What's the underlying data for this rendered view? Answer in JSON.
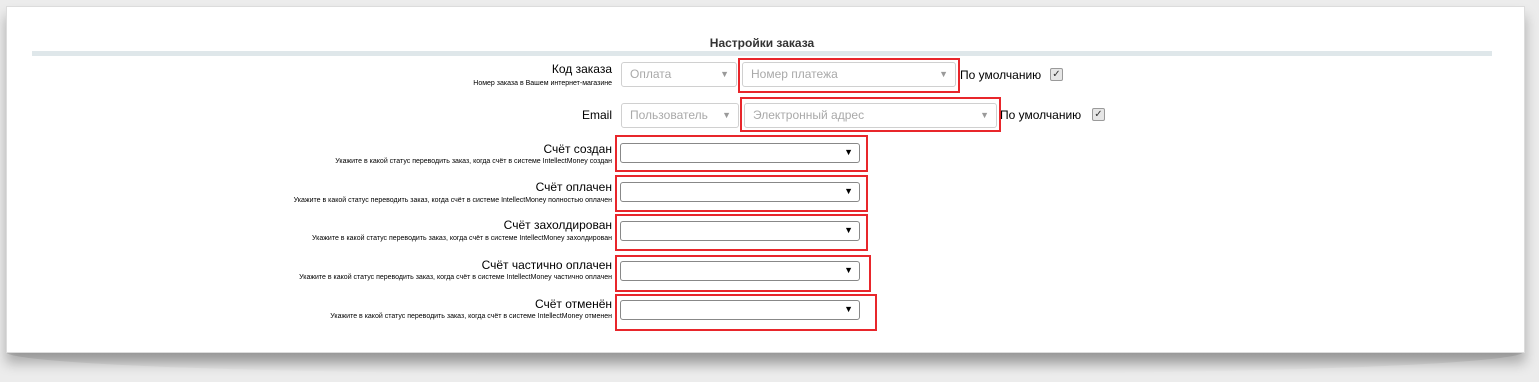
{
  "section_title": "Настройки заказа",
  "rows": {
    "order_code": {
      "label": "Код заказа",
      "hint": "Номер заказа в Вашем интернет-магазине",
      "source_value": "Оплата",
      "field_value": "Номер платежа",
      "default_label": "По умолчанию",
      "default_checked": true
    },
    "email": {
      "label": "Email",
      "source_value": "Пользователь",
      "field_value": "Электронный адрес",
      "default_label": "По умолчанию",
      "default_checked": true
    },
    "status_created": {
      "label": "Счёт создан",
      "hint": "Укажите в какой статус переводить заказ, когда счёт в системе IntellectMoney создан",
      "value": ""
    },
    "status_paid": {
      "label": "Счёт оплачен",
      "hint": "Укажите в какой статус переводить заказ, когда счёт в системе IntellectMoney полностью оплачен",
      "value": ""
    },
    "status_hold": {
      "label": "Счёт захолдирован",
      "hint": "Укажите в какой статус переводить заказ, когда счёт в системе IntellectMoney захолдирован",
      "value": ""
    },
    "status_partial": {
      "label": "Счёт частично оплачен",
      "hint": "Укажите в какой статус переводить заказ, когда счёт в системе IntellectMoney частично оплачен",
      "value": ""
    },
    "status_cancelled": {
      "label": "Счёт отменён",
      "hint": "Укажите в какой статус переводить заказ, когда счёт в системе IntellectMoney отменен",
      "value": ""
    }
  },
  "icons": {
    "dropdown": "triangle-down-icon",
    "checkbox": "checkmark-icon"
  },
  "colors": {
    "highlight": "#e8262b",
    "rule": "#dfe7ea"
  }
}
